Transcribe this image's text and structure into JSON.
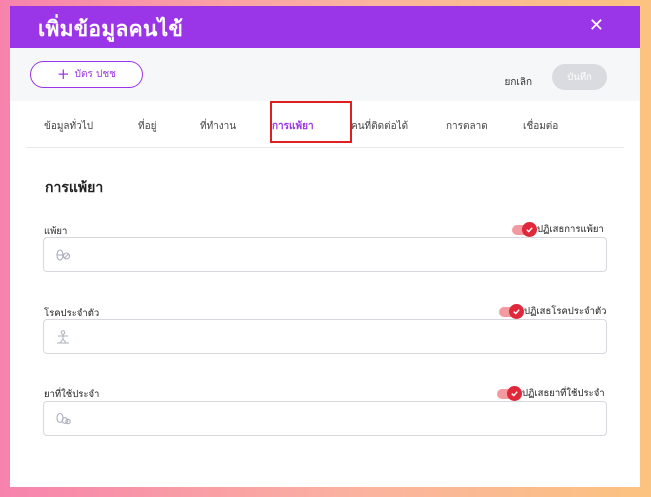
{
  "dialog": {
    "title": "เพิ่มข้อมูลคนไข้",
    "close_glyph": "✕"
  },
  "toolbar": {
    "add_label": "บัตร ปชช",
    "cancel_label": "ยกเลิก",
    "save_label": "บันทึก"
  },
  "tabs": [
    {
      "label": "ข้อมูลทั่วไป",
      "active": false
    },
    {
      "label": "ที่อยู่",
      "active": false
    },
    {
      "label": "ที่ทำงาน",
      "active": false
    },
    {
      "label": "การแพ้ยา",
      "active": true
    },
    {
      "label": "คนที่ติดต่อได้",
      "active": false
    },
    {
      "label": "การตลาด",
      "active": false
    },
    {
      "label": "เชื่อมต่อ",
      "active": false
    }
  ],
  "section": {
    "title": "การแพ้ยา"
  },
  "fields": [
    {
      "label": "แพ้ยา",
      "toggle_label": "ปฏิเสธการแพ้ยา",
      "toggle_on": true,
      "icon": "pills-icon"
    },
    {
      "label": "โรคประจำตัว",
      "toggle_label": "ปฏิเสธโรคประจำตัว",
      "toggle_on": true,
      "icon": "person-icon"
    },
    {
      "label": "ยาที่ใช้ประจำ",
      "toggle_label": "ปฏิเสธยาที่ใช้ประจำ",
      "toggle_on": true,
      "icon": "medicine-icon"
    }
  ],
  "colors": {
    "accent": "#9b35e8",
    "toggle_knob": "#e0283a",
    "toggle_track": "#f39aa0"
  }
}
